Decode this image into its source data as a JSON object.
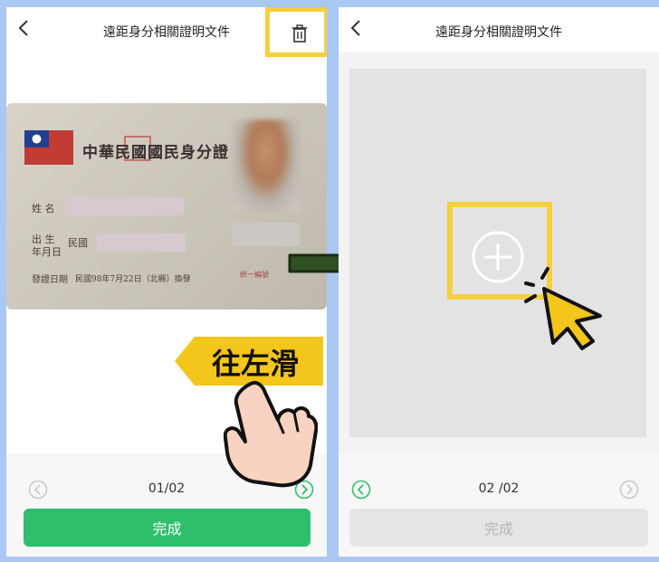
{
  "left_screen": {
    "title": "遠距身分相關證明文件",
    "icons": {
      "back": "chevron-left-icon",
      "delete": "trash-icon"
    },
    "id_card": {
      "title": "中華民國國民身分證",
      "name_label": "姓 名",
      "birth_label_line1": "出 生",
      "birth_label_line2": "年月日",
      "birth_value": "民國",
      "issue_label": "發證日期",
      "issue_value": "民國98年7月22日（北縣）換發",
      "photo_note": "統一編號"
    },
    "overlay_text": "往左滑",
    "pager": {
      "text": "01/02"
    },
    "done_button": "完成",
    "colors": {
      "accent_green": "#2fbf6c",
      "highlight_yellow": "#f4d03f"
    }
  },
  "right_screen": {
    "title": "遠距身分相關證明文件",
    "icons": {
      "back": "chevron-left-icon",
      "add": "plus-circle-icon",
      "cursor": "pointer-cursor-icon"
    },
    "pager": {
      "text": "02 /02"
    },
    "done_button": "完成"
  }
}
